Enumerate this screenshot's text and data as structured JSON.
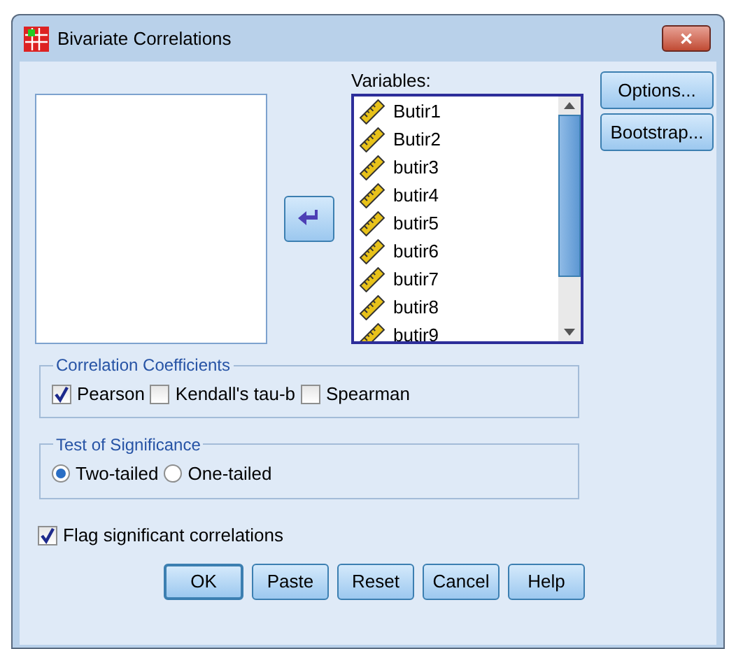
{
  "window": {
    "title": "Bivariate Correlations",
    "close": "✕"
  },
  "variables": {
    "label": "Variables:",
    "items": [
      "Butir1",
      "Butir2",
      "butir3",
      "butir4",
      "butir5",
      "butir6",
      "butir7",
      "butir8",
      "butir9"
    ]
  },
  "side_buttons": [
    "Options...",
    "Bootstrap..."
  ],
  "correlation_coefficients": {
    "title": "Correlation Coefficients",
    "options": [
      {
        "label": "Pearson",
        "checked": true
      },
      {
        "label": "Kendall's tau-b",
        "checked": false
      },
      {
        "label": "Spearman",
        "checked": false
      }
    ]
  },
  "test_of_significance": {
    "title": "Test of Significance",
    "options": [
      {
        "label": "Two-tailed",
        "selected": true
      },
      {
        "label": "One-tailed",
        "selected": false
      }
    ]
  },
  "flag": {
    "label": "Flag significant correlations",
    "checked": true
  },
  "buttons": [
    {
      "label": "OK",
      "default": true
    },
    {
      "label": "Paste",
      "default": false
    },
    {
      "label": "Reset",
      "default": false
    },
    {
      "label": "Cancel",
      "default": false
    },
    {
      "label": "Help",
      "default": false
    }
  ]
}
